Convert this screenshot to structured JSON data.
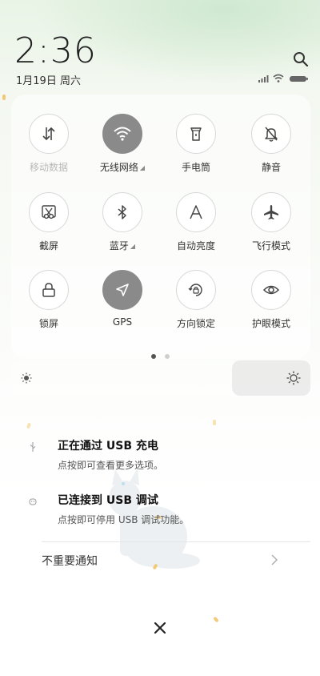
{
  "header": {
    "time": "2:36",
    "date": "1月19日 周六"
  },
  "icons": {
    "search": "search-icon",
    "signal": "signal-icon",
    "wifi_status": "wifi-icon",
    "battery": "battery-icon"
  },
  "quick_tiles": [
    {
      "id": "mobile-data",
      "label": "移动数据",
      "icon": "mobile-data-icon",
      "active": false,
      "dim": true,
      "expand": false
    },
    {
      "id": "wifi",
      "label": "无线网络",
      "icon": "wifi-icon",
      "active": true,
      "dim": false,
      "expand": true
    },
    {
      "id": "flashlight",
      "label": "手电筒",
      "icon": "flashlight-icon",
      "active": false,
      "dim": false,
      "expand": false
    },
    {
      "id": "mute",
      "label": "静音",
      "icon": "bell-off-icon",
      "active": false,
      "dim": false,
      "expand": false
    },
    {
      "id": "screenshot",
      "label": "截屏",
      "icon": "scissors-icon",
      "active": false,
      "dim": false,
      "expand": false
    },
    {
      "id": "bluetooth",
      "label": "蓝牙",
      "icon": "bluetooth-icon",
      "active": false,
      "dim": false,
      "expand": true
    },
    {
      "id": "auto-brightness",
      "label": "自动亮度",
      "icon": "letter-a-icon",
      "active": false,
      "dim": false,
      "expand": false
    },
    {
      "id": "airplane",
      "label": "飞行模式",
      "icon": "airplane-icon",
      "active": false,
      "dim": false,
      "expand": false
    },
    {
      "id": "lock-screen",
      "label": "锁屏",
      "icon": "lock-icon",
      "active": false,
      "dim": false,
      "expand": false
    },
    {
      "id": "gps",
      "label": "GPS",
      "icon": "location-arrow-icon",
      "active": true,
      "dim": false,
      "expand": false
    },
    {
      "id": "rotation-lock",
      "label": "方向锁定",
      "icon": "rotation-lock-icon",
      "active": false,
      "dim": false,
      "expand": false
    },
    {
      "id": "eye-care",
      "label": "护眼模式",
      "icon": "eye-icon",
      "active": false,
      "dim": false,
      "expand": false
    }
  ],
  "pager": {
    "pages": 2,
    "current": 1
  },
  "brightness": {
    "level": 0.25
  },
  "notifications": [
    {
      "title": "正在通过 USB 充电",
      "body": "点按即可查看更多选项。",
      "icon": "usb-icon"
    },
    {
      "title": "已连接到 USB 调试",
      "body": "点按即可停用 USB 调试功能。",
      "icon": "android-icon"
    }
  ],
  "unimportant_label": "不重要通知",
  "colors": {
    "active_tile": "#8a8a8a",
    "accent": "#202020"
  }
}
